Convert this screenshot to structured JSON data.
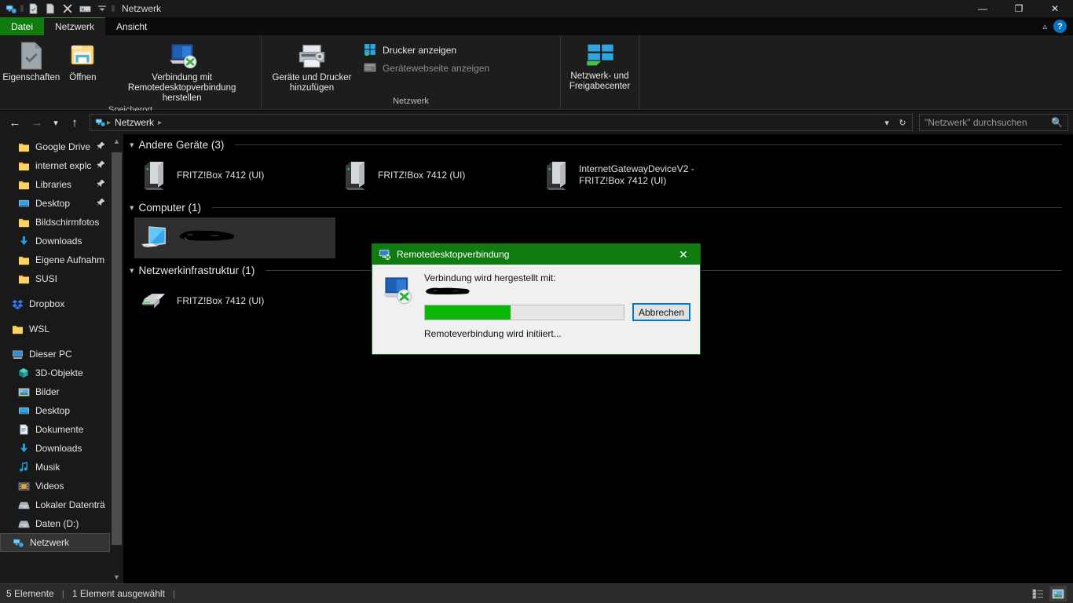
{
  "window": {
    "title": "Netzwerk",
    "quick_access": [
      "network-icon",
      "properties-icon",
      "new-folder-icon",
      "delete-icon",
      "rename-icon",
      "customize-dropdown-icon"
    ],
    "controls": {
      "minimize": "—",
      "maximize": "❐",
      "close": "✕"
    }
  },
  "ribbon": {
    "tabs": [
      {
        "label": "Datei",
        "kind": "file"
      },
      {
        "label": "Netzwerk",
        "kind": "active"
      },
      {
        "label": "Ansicht",
        "kind": "normal"
      }
    ],
    "collapse_icon": "chevron-up-icon",
    "help_icon": "?",
    "groups": [
      {
        "label": "Speicherort",
        "big_buttons": [
          {
            "label": "Eigenschaften",
            "icon": "properties-icon",
            "enabled": false
          },
          {
            "label": "Öffnen",
            "icon": "open-folder-icon",
            "enabled": true
          },
          {
            "label": "Verbindung mit Remotedesktopverbindung herstellen",
            "icon": "remote-desktop-icon",
            "enabled": true
          }
        ]
      },
      {
        "label": "Netzwerk",
        "big_buttons": [
          {
            "label": "Geräte und Drucker hinzufügen",
            "icon": "printer-add-icon",
            "enabled": true
          }
        ],
        "small_buttons": [
          {
            "label": "Drucker anzeigen",
            "icon": "printers-icon",
            "enabled": true
          },
          {
            "label": "Gerätewebseite anzeigen",
            "icon": "device-webpage-icon",
            "enabled": false
          }
        ],
        "big_buttons_tail": [
          {
            "label": "Netzwerk- und Freigabecenter",
            "icon": "network-sharing-icon",
            "enabled": true
          }
        ]
      }
    ]
  },
  "address": {
    "back_icon": "arrow-left-icon",
    "forward_icon": "arrow-right-icon",
    "recent_icon": "chevron-down-icon",
    "up_icon": "arrow-up-icon",
    "crumb_icon": "network-icon",
    "crumbs": [
      "Netzwerk"
    ],
    "dropdown_icon": "chevron-down-icon",
    "refresh_icon": "refresh-icon",
    "search_placeholder": "\"Netzwerk\" durchsuchen",
    "search_icon": "search-icon"
  },
  "sidebar": {
    "scroll_up_icon": "chevron-up-icon",
    "scroll_down_icon": "chevron-down-icon",
    "items": [
      {
        "label": "Google Drive",
        "icon": "folder-icon",
        "pinned": true,
        "indent": 1
      },
      {
        "label": "internet explc",
        "icon": "folder-icon",
        "pinned": true,
        "indent": 1
      },
      {
        "label": "Libraries",
        "icon": "folder-icon",
        "pinned": true,
        "indent": 1
      },
      {
        "label": "Desktop",
        "icon": "desktop-icon",
        "pinned": true,
        "indent": 1
      },
      {
        "label": "Bildschirmfotos",
        "icon": "folder-icon",
        "pinned": false,
        "indent": 1
      },
      {
        "label": "Downloads",
        "icon": "download-icon",
        "pinned": false,
        "indent": 1
      },
      {
        "label": "Eigene Aufnahm",
        "icon": "folder-icon",
        "pinned": false,
        "indent": 1
      },
      {
        "label": "SUSI",
        "icon": "folder-icon",
        "pinned": false,
        "indent": 1
      },
      {
        "label": "Dropbox",
        "icon": "dropbox-icon",
        "pinned": false,
        "indent": 0,
        "spacer_before": true
      },
      {
        "label": "WSL",
        "icon": "folder-icon",
        "pinned": false,
        "indent": 0,
        "spacer_before": true
      },
      {
        "label": "Dieser PC",
        "icon": "this-pc-icon",
        "pinned": false,
        "indent": 0,
        "spacer_before": true
      },
      {
        "label": "3D-Objekte",
        "icon": "3d-objects-icon",
        "pinned": false,
        "indent": 1
      },
      {
        "label": "Bilder",
        "icon": "pictures-icon",
        "pinned": false,
        "indent": 1
      },
      {
        "label": "Desktop",
        "icon": "desktop-icon",
        "pinned": false,
        "indent": 1
      },
      {
        "label": "Dokumente",
        "icon": "documents-icon",
        "pinned": false,
        "indent": 1
      },
      {
        "label": "Downloads",
        "icon": "download-icon",
        "pinned": false,
        "indent": 1
      },
      {
        "label": "Musik",
        "icon": "music-icon",
        "pinned": false,
        "indent": 1
      },
      {
        "label": "Videos",
        "icon": "videos-icon",
        "pinned": false,
        "indent": 1
      },
      {
        "label": "Lokaler Datenträ",
        "icon": "local-disk-icon",
        "pinned": false,
        "indent": 1
      },
      {
        "label": "Daten (D:)",
        "icon": "local-disk-icon",
        "pinned": false,
        "indent": 1
      },
      {
        "label": "Netzwerk",
        "icon": "network-icon",
        "pinned": false,
        "indent": 0,
        "selected": true
      }
    ]
  },
  "content": {
    "groups": [
      {
        "title": "Andere Geräte (3)",
        "count": 3,
        "expanded": true,
        "items": [
          {
            "label": "FRITZ!Box 7412 (UI)",
            "icon": "device-tower-icon",
            "selected": false
          },
          {
            "label": "FRITZ!Box 7412 (UI)",
            "icon": "device-tower-icon",
            "selected": false
          },
          {
            "label": "InternetGatewayDeviceV2 - FRITZ!Box 7412 (UI)",
            "icon": "device-tower-icon",
            "selected": false
          }
        ]
      },
      {
        "title": "Computer (1)",
        "count": 1,
        "expanded": true,
        "items": [
          {
            "label": "",
            "redacted": true,
            "icon": "computer-icon",
            "selected": true
          }
        ]
      },
      {
        "title": "Netzwerkinfrastruktur (1)",
        "count": 1,
        "expanded": true,
        "items": [
          {
            "label": "FRITZ!Box 7412 (UI)",
            "icon": "router-icon",
            "selected": false
          }
        ]
      }
    ]
  },
  "statusbar": {
    "item_count": "5 Elemente",
    "selection": "1 Element ausgewählt",
    "views": [
      {
        "name": "details-view-icon",
        "active": false
      },
      {
        "name": "large-icons-view-icon",
        "active": true
      }
    ]
  },
  "dialog": {
    "title": "Remotedesktopverbindung",
    "title_icon": "remote-desktop-icon",
    "close_icon": "✕",
    "body_icon": "remote-desktop-large-icon",
    "line1": "Verbindung wird hergestellt mit:",
    "target_redacted": true,
    "progress_percent": 43,
    "progress_color": "#0ab80a",
    "cancel_label": "Abbrechen",
    "status": "Remoteverbindung wird initiiert...",
    "accent": "#107c10"
  }
}
